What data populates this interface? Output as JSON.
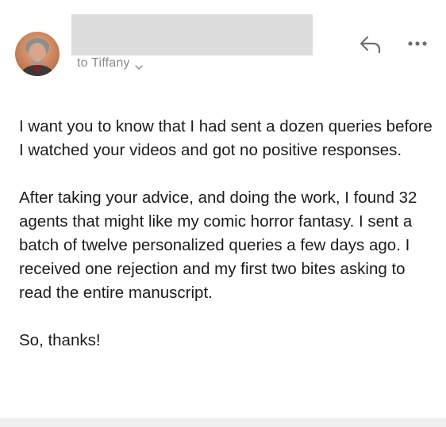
{
  "header": {
    "recipient_text": "to Tiffany"
  },
  "icons": {
    "avatar": "avatar",
    "reply": "reply-arrow-icon",
    "more": "more-dots-icon",
    "chevron": "chevron-down-icon"
  },
  "message": {
    "paragraphs": [
      "I want you to know that I had sent a dozen queries before I watched your videos and got no positive responses.",
      "After taking your advice, and doing the work, I found 32 agents that might like my comic horror fantasy. I sent a batch of twelve personalized queries a few days ago. I received one rejection and my first two bites asking to read the entire manuscript.",
      "So, thanks!"
    ]
  },
  "colors": {
    "icon_gray": "#6e6e73",
    "text": "#1c1c1e",
    "secondary_text": "#8a8a8e"
  }
}
